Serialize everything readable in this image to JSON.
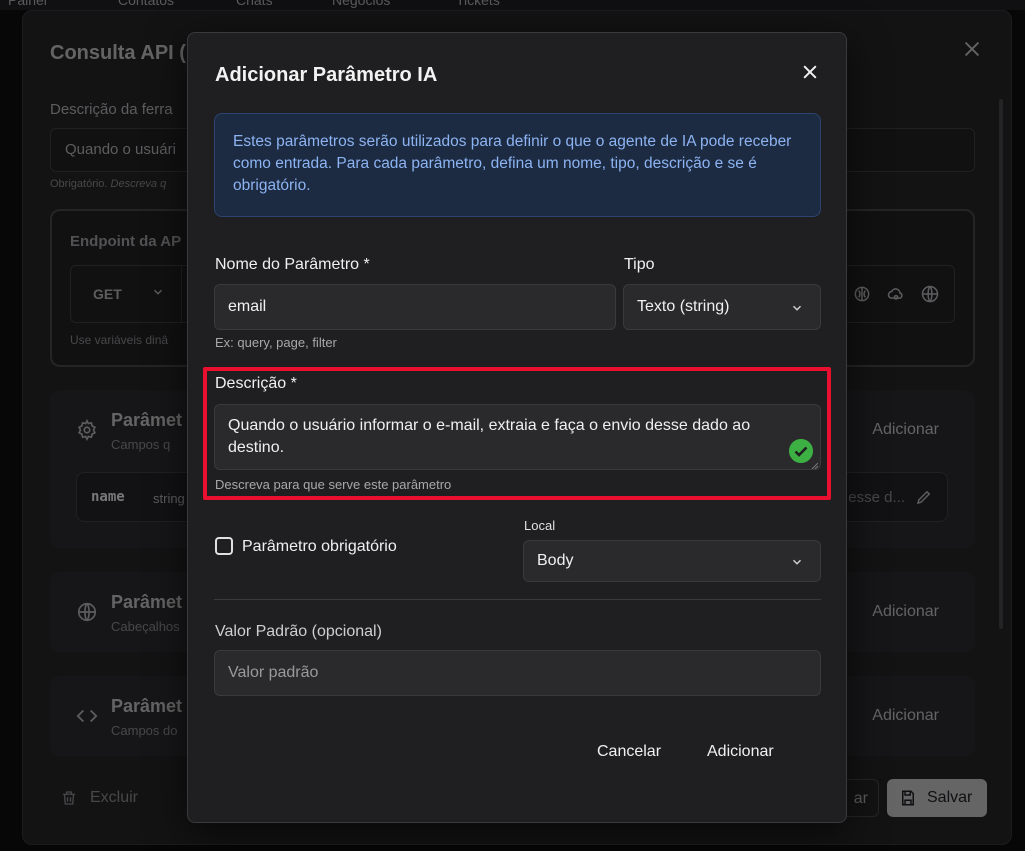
{
  "background": {
    "nav_items": [
      "Painel",
      "Contatos",
      "Chats",
      "Negócios",
      "Tickets"
    ],
    "title": "Consulta API (",
    "description_label": "Descrição da ferra",
    "description_value": "Quando o usuári",
    "description_hint_prefix": "Obrigatório.",
    "description_hint_italic": "Descreva q",
    "endpoint_title": "Endpoint da AP",
    "method": "GET",
    "endpoint_hint": "Use variáveis dinâ",
    "cards": [
      {
        "title": "Parâmet",
        "subtitle": "Campos q",
        "add": "Adicionar",
        "icon": "gear-icon"
      },
      {
        "title": "Parâmet",
        "subtitle": "Cabeçalhos",
        "add": "Adicionar",
        "icon": "globe-icon"
      },
      {
        "title": "Parâmet",
        "subtitle": "Campos do",
        "add": "Adicionar",
        "icon": "code-icon"
      }
    ],
    "param_row": {
      "name": "name",
      "type": "string",
      "desc": "esse d..."
    },
    "footer": {
      "delete": "Excluir",
      "cancel": "ar",
      "save": "Salvar"
    }
  },
  "modal": {
    "title": "Adicionar Parâmetro IA",
    "info": "Estes parâmetros serão utilizados para definir o que o agente de IA pode receber como entrada. Para cada parâmetro, defina um nome, tipo, descrição e se é obrigatório.",
    "name_label": "Nome do Parâmetro *",
    "name_value": "email",
    "name_hint": "Ex: query, page, filter",
    "type_label": "Tipo",
    "type_value": "Texto (string)",
    "description_label": "Descrição *",
    "description_value": "Quando o usuário informar o e-mail, extraia e faça o envio desse dado ao destino.",
    "description_hint": "Descreva para que serve este parâmetro",
    "required_label": "Parâmetro obrigatório",
    "location_label": "Local",
    "location_value": "Body",
    "default_label": "Valor Padrão (opcional)",
    "default_placeholder": "Valor padrão",
    "cancel_label": "Cancelar",
    "add_label": "Adicionar"
  },
  "colors": {
    "highlight": "#e8102e",
    "info_bg": "#1c2a42",
    "info_text": "#8db4f2",
    "success": "#3cb043"
  }
}
